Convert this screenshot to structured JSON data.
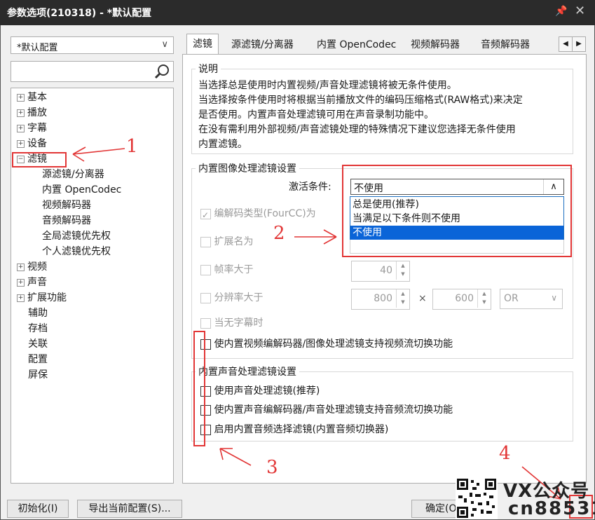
{
  "window": {
    "title": "参数选项(210318) - *默认配置"
  },
  "profile_combo": {
    "value": "*默认配置"
  },
  "tree": {
    "items": [
      {
        "label": "基本",
        "expander": "+"
      },
      {
        "label": "播放",
        "expander": "+"
      },
      {
        "label": "字幕",
        "expander": "+"
      },
      {
        "label": "设备",
        "expander": "+"
      },
      {
        "label": "滤镜",
        "expander": "−"
      },
      {
        "label": "源滤镜/分离器"
      },
      {
        "label": "内置 OpenCodec"
      },
      {
        "label": "视频解码器"
      },
      {
        "label": "音频解码器"
      },
      {
        "label": "全局滤镜优先权"
      },
      {
        "label": "个人滤镜优先权"
      },
      {
        "label": "视频",
        "expander": "+"
      },
      {
        "label": "声音",
        "expander": "+"
      },
      {
        "label": "扩展功能",
        "expander": "+"
      },
      {
        "label": "辅助"
      },
      {
        "label": "存档"
      },
      {
        "label": "关联"
      },
      {
        "label": "配置"
      },
      {
        "label": "屏保"
      }
    ]
  },
  "tabs": [
    "滤镜",
    "源滤镜/分离器",
    "内置 OpenCodec",
    "视频解码器",
    "音频解码器"
  ],
  "description": {
    "title": "说明",
    "lines": [
      "当选择总是使用时内置视频/声音处理滤镜将被无条件使用。",
      "当选择按条件使用时将根据当前播放文件的编码压缩格式(RAW格式)来决定",
      "是否使用。内置声音处理滤镜可用在声音录制功能中。",
      "在没有需利用外部视频/声音滤镜处理的特殊情况下建议您选择无条件使用",
      "内置滤镜。"
    ]
  },
  "video_group": {
    "title": "内置图像处理滤镜设置",
    "activate_label": "激活条件:",
    "activate_value": "不使用",
    "dropdown_options": [
      "总是使用(推荐)",
      "当满足以下条件则不使用",
      "不使用"
    ],
    "selected_index": 2,
    "codec_type_label": "编解码类型(FourCC)为",
    "ext_label": "扩展名为",
    "fps_label": "帧率大于",
    "fps_value": "40",
    "res_label": "分辨率大于",
    "res_width": "800",
    "res_times": "×",
    "res_height": "600",
    "res_op": "OR",
    "no_sub_label": "当无字幕时",
    "stream_switch_label": "使内置视频编解码器/图像处理滤镜支持视频流切换功能"
  },
  "audio_group": {
    "title": "内置声音处理滤镜设置",
    "opt1": "使用声音处理滤镜(推荐)",
    "opt2": "使内置声音编解码器/声音处理滤镜支持音频流切换功能",
    "opt3": "启用内置音频选择滤镜(内置音频切换器)"
  },
  "buttons": {
    "init": "初始化(I)",
    "export": "导出当前配置(S)...",
    "ok": "确定(O)"
  },
  "annotations": [
    "1",
    "2",
    "3",
    "4"
  ],
  "watermark": {
    "line1": "VX公众号",
    "line2": "cn88531"
  },
  "colors": {
    "annotation_red": "#e23636",
    "selection_blue": "#0a64d8",
    "titlebar": "#2b2b2b"
  }
}
